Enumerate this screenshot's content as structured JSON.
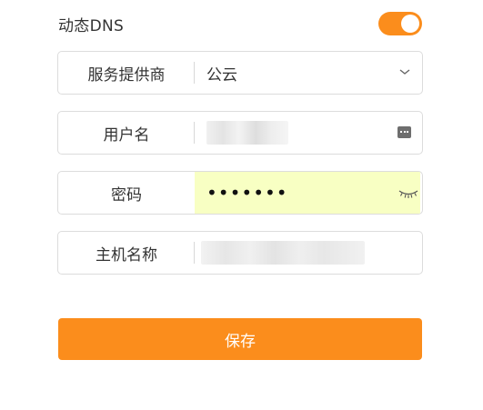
{
  "ddns": {
    "label": "动态DNS",
    "toggle_on": true
  },
  "fields": {
    "provider": {
      "label": "服务提供商",
      "value": "公云"
    },
    "username": {
      "label": "用户名"
    },
    "password": {
      "label": "密码",
      "value": "•••••••"
    },
    "hostname": {
      "label": "主机名称"
    }
  },
  "actions": {
    "save_label": "保存"
  },
  "colors": {
    "accent": "#fb8d1c",
    "autofill": "#f8ffc3",
    "border": "#dcdcdc"
  },
  "icons": {
    "provider_dropdown": "chevron-down-icon",
    "username_field": "keyboard-icon",
    "password_field": "eye-closed-icon"
  }
}
